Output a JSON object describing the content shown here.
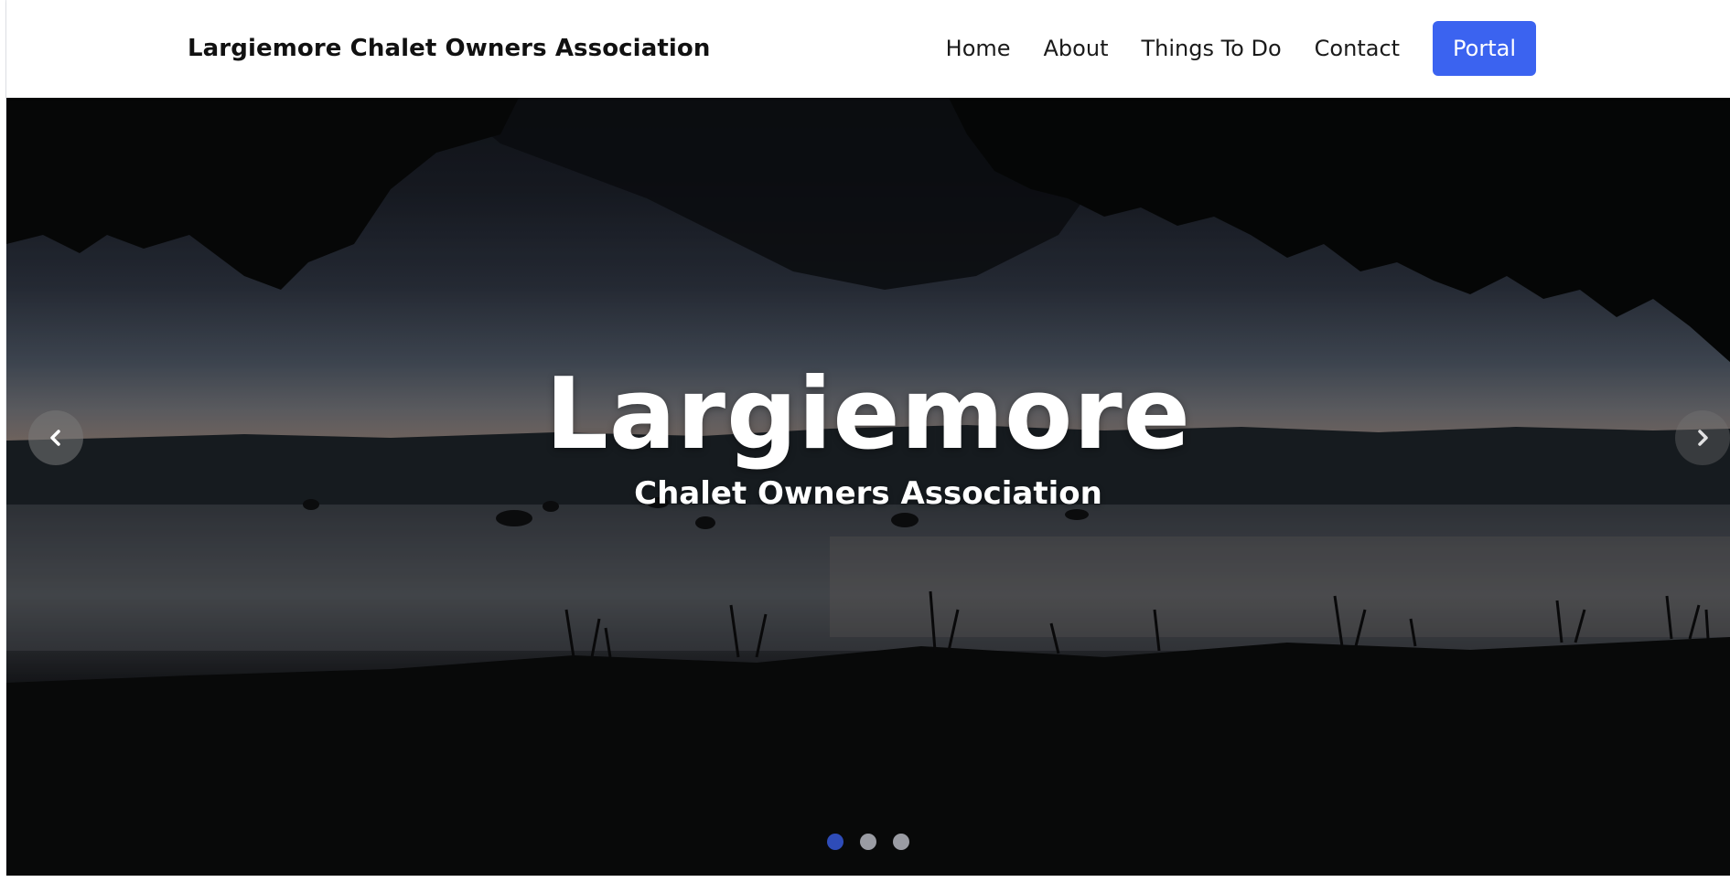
{
  "header": {
    "brand": "Largiemore Chalet Owners Association",
    "nav": [
      {
        "label": "Home"
      },
      {
        "label": "About"
      },
      {
        "label": "Things To Do"
      },
      {
        "label": "Contact"
      }
    ],
    "portal_label": "Portal"
  },
  "hero": {
    "title": "Largiemore",
    "subtitle": "Chalet Owners Association",
    "prev_icon": "chevron-left-icon",
    "next_icon": "chevron-right-icon",
    "slide_count": 3,
    "active_slide": 1
  },
  "colors": {
    "accent": "#3b63f0",
    "active_dot": "#2e4cb8",
    "inactive_dot": "#9a9ca3"
  }
}
